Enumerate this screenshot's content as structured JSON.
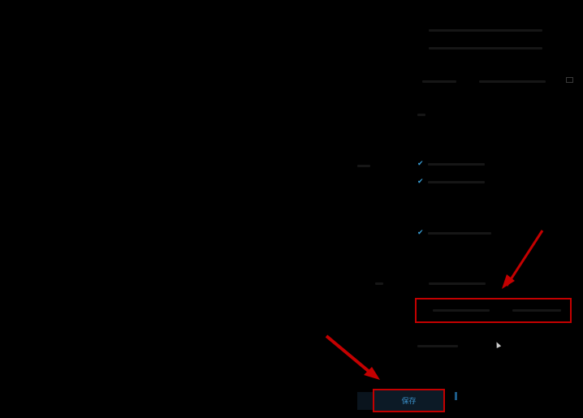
{
  "annotation_color": "#c40000",
  "accent_color": "#3aa0d8",
  "icons": {
    "folder": "folder-icon",
    "check": "checkmark-icon",
    "cursor": "cursor-icon"
  },
  "form": {
    "checkbox_group_1": [
      {
        "checked": true
      },
      {
        "checked": true
      }
    ],
    "checkbox_group_2": [
      {
        "checked": true
      }
    ],
    "save_button": {
      "label": "保存"
    }
  }
}
